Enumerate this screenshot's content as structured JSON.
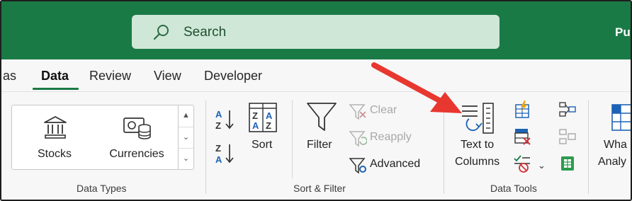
{
  "search": {
    "label": "Search"
  },
  "user": {
    "label": "Pu"
  },
  "tabs": [
    {
      "label": "as"
    },
    {
      "label": "Data"
    },
    {
      "label": "Review"
    },
    {
      "label": "View"
    },
    {
      "label": "Developer"
    }
  ],
  "data_types": {
    "stocks_label": "Stocks",
    "currencies_label": "Currencies",
    "group_label": "Data Types"
  },
  "sort_filter": {
    "sort_label": "Sort",
    "filter_label": "Filter",
    "clear_label": "Clear",
    "reapply_label": "Reapply",
    "advanced_label": "Advanced",
    "group_label": "Sort & Filter"
  },
  "data_tools": {
    "text_to_columns_line1": "Text to",
    "text_to_columns_line2": "Columns",
    "group_label": "Data Tools"
  },
  "what_if": {
    "line1": "Wha",
    "line2": "Analy"
  },
  "colors": {
    "title_bar": "#1a7a45",
    "accent": "#1a7a45",
    "arrow": "#e8372f"
  }
}
